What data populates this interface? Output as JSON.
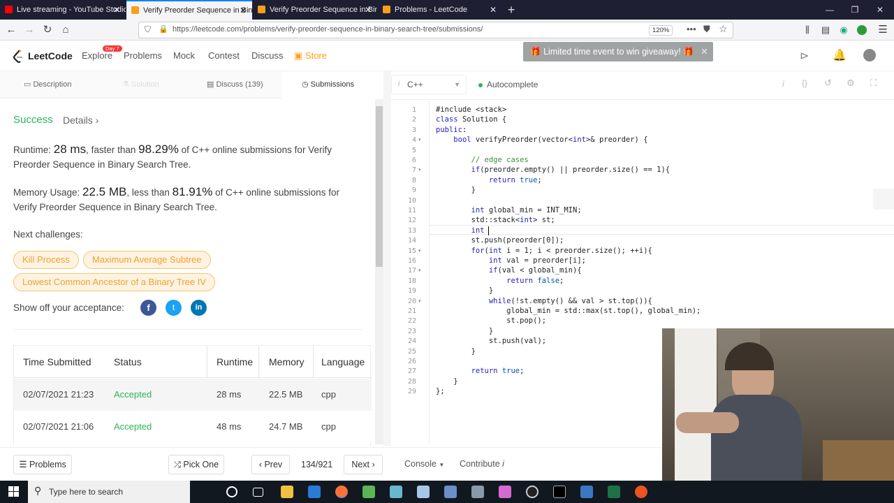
{
  "browser": {
    "tabs": [
      {
        "title": "Live streaming - YouTube Studio",
        "favicon_color": "#ff0000"
      },
      {
        "title": "Verify Preorder Sequence in Binary",
        "favicon_color": "#f89f1b"
      },
      {
        "title": "Verify Preorder Sequence in Binary",
        "favicon_color": "#f89f1b"
      },
      {
        "title": "Problems - LeetCode",
        "favicon_color": "#f89f1b"
      }
    ],
    "url": "https://leetcode.com/problems/verify-preorder-sequence-in-binary-search-tree/submissions/",
    "zoom": "120%"
  },
  "leetcode": {
    "logo": "LeetCode",
    "badge": "Day 7",
    "nav": [
      "Explore",
      "Problems",
      "Mock",
      "Contest",
      "Discuss",
      "Store"
    ],
    "giveaway": "Limited time event to win giveaway!",
    "tabs": [
      "Description",
      "Solution",
      "Discuss (139)",
      "Submissions"
    ]
  },
  "result": {
    "status": "Success",
    "details": "Details",
    "runtime_label": "Runtime:",
    "runtime_value": "28 ms",
    "runtime_mid": ", faster than",
    "runtime_pct": "98.29%",
    "runtime_tail": "of C++ online submissions for Verify Preorder Sequence in Binary Search Tree.",
    "memory_label": "Memory Usage:",
    "memory_value": "22.5 MB",
    "memory_mid": ", less than",
    "memory_pct": "81.91%",
    "memory_tail": "of C++ online submissions for Verify Preorder Sequence in Binary Search Tree.",
    "next_label": "Next challenges:",
    "challenges": [
      "Kill Process",
      "Maximum Average Subtree",
      "Lowest Common Ancestor of a Binary Tree IV"
    ],
    "share_label": "Show off your acceptance:",
    "table": {
      "headers": [
        "Time Submitted",
        "Status",
        "Runtime",
        "Memory",
        "Language"
      ],
      "rows": [
        [
          "02/07/2021 21:23",
          "Accepted",
          "28 ms",
          "22.5 MB",
          "cpp"
        ],
        [
          "02/07/2021 21:06",
          "Accepted",
          "48 ms",
          "24.7 MB",
          "cpp"
        ]
      ]
    }
  },
  "editor": {
    "language": "C++",
    "autocomplete": "Autocomplete",
    "lines": [
      "#include <stack>",
      "class Solution {",
      "public:",
      "    bool verifyPreorder(vector<int>& preorder) {",
      "",
      "        // edge cases",
      "        if(preorder.empty() || preorder.size() == 1){",
      "            return true;",
      "        }",
      "",
      "        int global_min = INT_MIN;",
      "        std::stack<int> st;",
      "        int",
      "        st.push(preorder[0]);",
      "        for(int i = 1; i < preorder.size(); ++i){",
      "            int val = preorder[i];",
      "            if(val < global_min){",
      "                return false;",
      "            }",
      "            while(!st.empty() && val > st.top()){",
      "                global_min = std::max(st.top(), global_min);",
      "                st.pop();",
      "            }",
      "            st.push(val);",
      "        }",
      "",
      "        return true;",
      "    }",
      "};"
    ]
  },
  "bottom": {
    "problems": "Problems",
    "pick_one": "Pick One",
    "prev": "Prev",
    "page": "134/921",
    "next": "Next",
    "console": "Console",
    "contribute": "Contribute"
  },
  "taskbar": {
    "search_placeholder": "Type here to search"
  },
  "colors": {
    "accent_green": "#2db55d",
    "orange": "#ffa116"
  }
}
